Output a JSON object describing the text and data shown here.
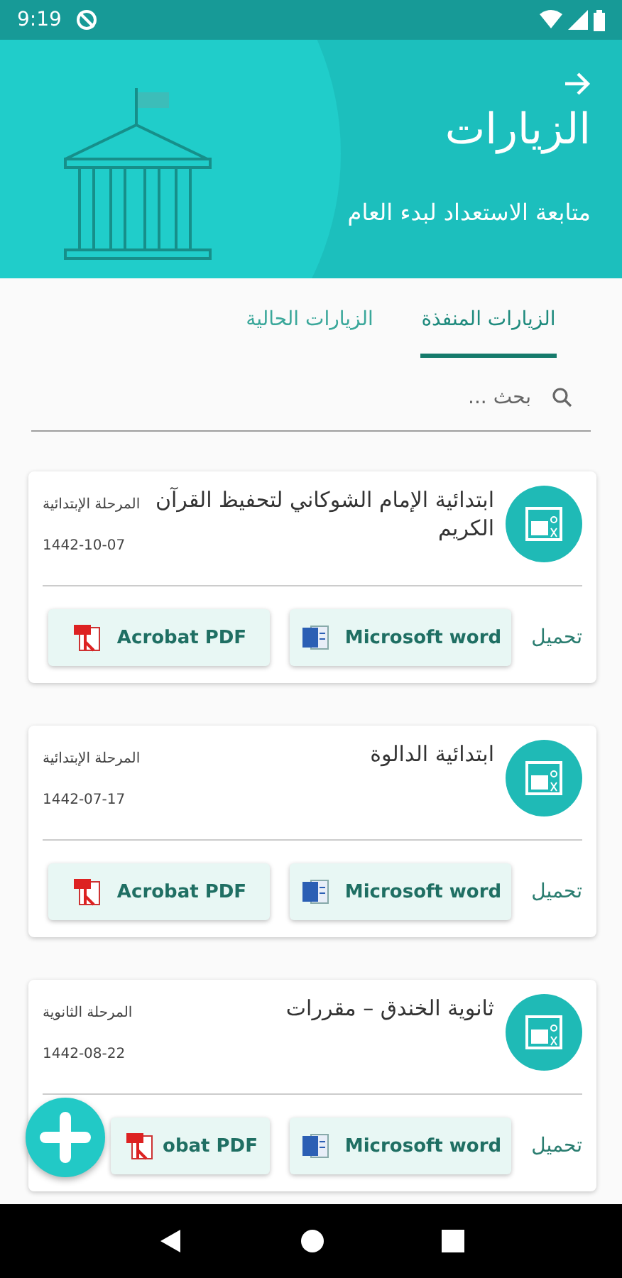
{
  "status_bar": {
    "time": "9:19"
  },
  "header": {
    "title": "الزيارات",
    "subtitle": "متابعة الاستعداد لبدء العام"
  },
  "tabs": [
    {
      "label": "الزيارات المنفذة",
      "selected": true
    },
    {
      "label": "الزيارات الحالية",
      "selected": false
    }
  ],
  "search": {
    "placeholder": "بحث ..."
  },
  "visits": [
    {
      "title": "ابتدائية الإمام الشوكاني لتحفيظ القرآن الكريم",
      "stage": "المرحلة الإبتدائية",
      "date": "1442-10-07",
      "download_label": "تحميل",
      "word_button": "Microsoft word",
      "pdf_button": "Acrobat PDF"
    },
    {
      "title": "ابتدائية الدالوة",
      "stage": "المرحلة الإبتدائية",
      "date": "1442-07-17",
      "download_label": "تحميل",
      "word_button": "Microsoft word",
      "pdf_button": "Acrobat PDF"
    },
    {
      "title": "ثانوية الخندق – مقررات",
      "stage": "المرحلة الثانوية",
      "date": "1442-08-22",
      "download_label": "تحميل",
      "word_button": "Microsoft word",
      "pdf_button": "obat PDF"
    }
  ]
}
